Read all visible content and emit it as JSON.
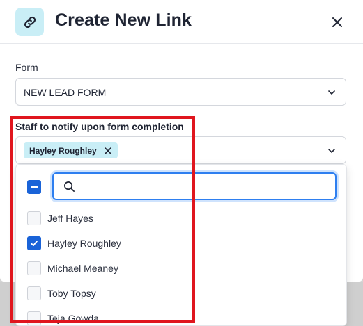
{
  "header": {
    "title": "Create New Link",
    "icon": "link-icon",
    "close_icon": "close-icon"
  },
  "form_field": {
    "label": "Form",
    "value": "NEW LEAD FORM"
  },
  "staff_field": {
    "label": "Staff to notify upon form completion",
    "selected_tags": [
      "Hayley Roughley"
    ]
  },
  "dropdown": {
    "search_placeholder": "",
    "options": [
      {
        "label": "Jeff Hayes",
        "checked": false
      },
      {
        "label": "Hayley Roughley",
        "checked": true
      },
      {
        "label": "Michael Meaney",
        "checked": false
      },
      {
        "label": "Toby Topsy",
        "checked": false
      },
      {
        "label": "Teja Gowda",
        "checked": false
      }
    ]
  },
  "colors": {
    "accent": "#1a63d8",
    "icon_bg": "#c9eef6",
    "highlight": "#e0161e"
  }
}
